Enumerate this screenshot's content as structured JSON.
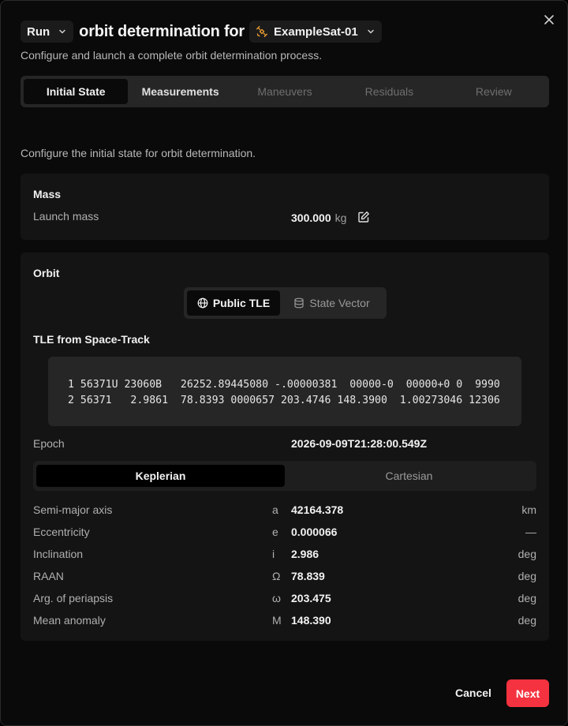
{
  "header": {
    "mode_select": "Run",
    "title": "orbit determination for",
    "satellite_select": "ExampleSat-01",
    "subtitle": "Configure and launch a complete orbit determination process."
  },
  "tabs": [
    {
      "label": "Initial State",
      "state": "active"
    },
    {
      "label": "Measurements",
      "state": "enabled"
    },
    {
      "label": "Maneuvers",
      "state": "disabled"
    },
    {
      "label": "Residuals",
      "state": "disabled"
    },
    {
      "label": "Review",
      "state": "disabled"
    }
  ],
  "intro": "Configure the initial state for orbit determination.",
  "mass": {
    "title": "Mass",
    "label": "Launch mass",
    "value": "300.000",
    "unit": "kg"
  },
  "orbit": {
    "title": "Orbit",
    "source_options": [
      {
        "label": "Public TLE",
        "icon": "globe-icon",
        "active": true
      },
      {
        "label": "State Vector",
        "icon": "database-icon",
        "active": false
      }
    ],
    "tle_title": "TLE from Space-Track",
    "tle_line1": "1 56371U 23060B   26252.89445080 -.00000381  00000-0  00000+0 0  9990",
    "tle_line2": "2 56371   2.9861  78.8393 0000657 203.4746 148.3900  1.00273046 12306",
    "epoch_label": "Epoch",
    "epoch_value": "2026-09-09T21:28:00.549Z",
    "element_tabs": [
      {
        "label": "Keplerian",
        "active": true
      },
      {
        "label": "Cartesian",
        "active": false
      }
    ],
    "elements": [
      {
        "name": "Semi-major axis",
        "symbol": "a",
        "value": "42164.378",
        "unit": "km"
      },
      {
        "name": "Eccentricity",
        "symbol": "e",
        "value": "0.000066",
        "unit": "—"
      },
      {
        "name": "Inclination",
        "symbol": "i",
        "value": "2.986",
        "unit": "deg"
      },
      {
        "name": "RAAN",
        "symbol": "Ω",
        "value": "78.839",
        "unit": "deg"
      },
      {
        "name": "Arg. of periapsis",
        "symbol": "ω",
        "value": "203.475",
        "unit": "deg"
      },
      {
        "name": "Mean anomaly",
        "symbol": "M",
        "value": "148.390",
        "unit": "deg"
      }
    ]
  },
  "footer": {
    "cancel_label": "Cancel",
    "next_label": "Next"
  },
  "colors": {
    "accent": "#f5323f",
    "satellite_icon": "#f0a030"
  }
}
